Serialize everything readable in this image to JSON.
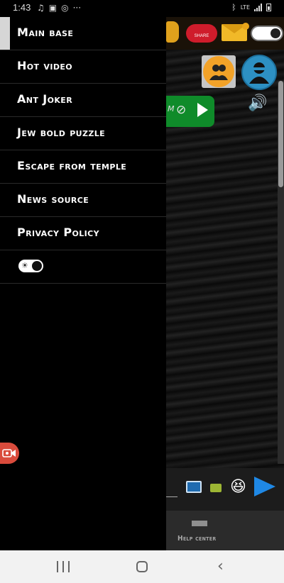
{
  "status_bar": {
    "time": "1:43",
    "notification_icons": [
      "music-icon",
      "image-icon",
      "instagram-icon",
      "more-dots-icon"
    ],
    "network_label": "LTE"
  },
  "drawer": {
    "items": [
      {
        "label": "Main base",
        "active": true
      },
      {
        "label": "Hot video",
        "active": false
      },
      {
        "label": "Ant Joker",
        "active": false
      },
      {
        "label": "Jew bold puzzle",
        "active": false
      },
      {
        "label": "Escape from temple",
        "active": false
      },
      {
        "label": "News source",
        "active": false
      },
      {
        "label": "Privacy Policy",
        "active": false
      }
    ],
    "theme_toggle_icon": "sun-icon"
  },
  "background_app": {
    "share_label": "SHARE",
    "help_center_label": "Help center",
    "emoji": "😆",
    "colors": {
      "share": "#cf1c2b",
      "mail": "#f1b928",
      "avatar": "#2d90c3",
      "group": "#f2a228",
      "green_bar": "#0f8b2a",
      "send": "#1f88e5",
      "record": "#d94b3c"
    }
  },
  "nav_bar": {
    "buttons": [
      "recent-apps-icon",
      "home-icon",
      "back-icon"
    ]
  }
}
